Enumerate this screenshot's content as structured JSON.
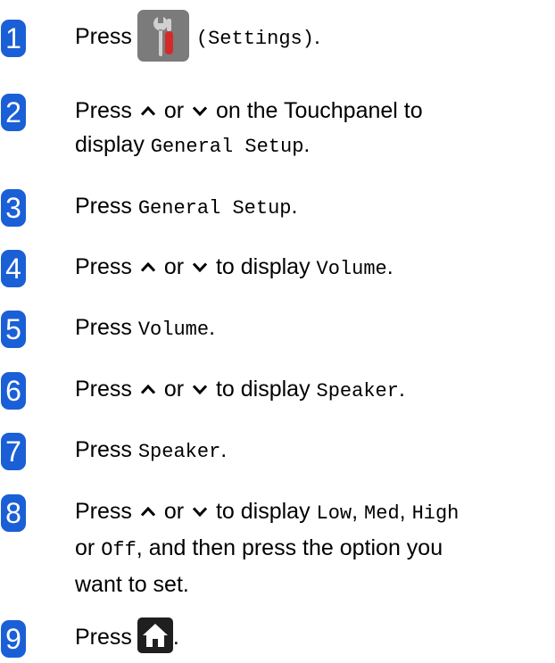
{
  "colors": {
    "badge": "#1a5fd6",
    "settings_button_bg": "#7b7b7b",
    "home_button_bg": "#1f1f1f",
    "tool_red": "#d62a2a",
    "tool_gray": "#d0d0d0"
  },
  "icons": {
    "up": "caret-up-icon",
    "down": "caret-down-icon",
    "settings": "settings-tools-icon",
    "home": "home-icon"
  },
  "steps": [
    {
      "number": "1",
      "press": "Press",
      "mono": "(Settings)",
      "end": "."
    },
    {
      "number": "2",
      "press": "Press",
      "or": "or",
      "text": "on the Touchpanel to",
      "line2_start": "display",
      "mono": "General Setup",
      "end": "."
    },
    {
      "number": "3",
      "press": "Press",
      "mono": "General Setup",
      "end": "."
    },
    {
      "number": "4",
      "press": "Press",
      "or": "or",
      "text": "to display",
      "mono": "Volume",
      "end": "."
    },
    {
      "number": "5",
      "press": "Press",
      "mono": "Volume",
      "end": "."
    },
    {
      "number": "6",
      "press": "Press",
      "or": "or",
      "text": "to display",
      "mono": "Speaker",
      "end": "."
    },
    {
      "number": "7",
      "press": "Press",
      "mono": "Speaker",
      "end": "."
    },
    {
      "number": "8",
      "press": "Press",
      "or": "or",
      "text": "to display",
      "opt1": "Low",
      "sep1": ",",
      "opt2": "Med",
      "sep2": ",",
      "opt3": "High",
      "line2_or": "or",
      "opt4": "Off",
      "line2_rest": ", and then press the option you",
      "line3": "want to set."
    },
    {
      "number": "9",
      "press": "Press",
      "end": "."
    }
  ]
}
